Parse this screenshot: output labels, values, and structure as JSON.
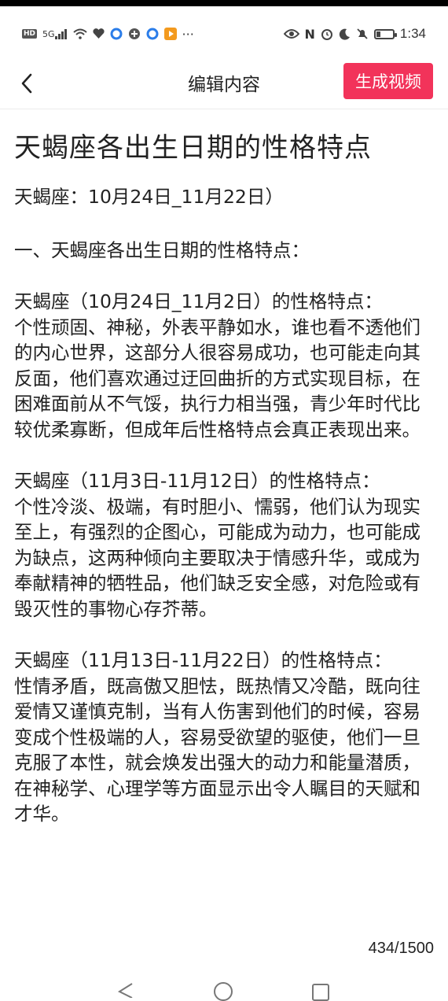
{
  "status_bar": {
    "time": "1:34",
    "left_icons": [
      "hd-icon",
      "signal-icon",
      "wifi-icon",
      "heart-icon",
      "app-c-icon",
      "app-g-icon",
      "app-c2-icon",
      "video-app-icon",
      "more-icon"
    ],
    "right_icons": [
      "eye-icon",
      "nfc-icon",
      "alarm-icon",
      "moon-icon",
      "silent-icon",
      "battery-icon"
    ],
    "hd_label": "HD",
    "signal_label": "5G",
    "more_label": "···",
    "nfc_label": "N"
  },
  "navbar": {
    "title": "编辑内容",
    "action_label": "生成视频",
    "action_color": "#f2335a"
  },
  "document": {
    "title": "天蝎座各出生日期的性格特点",
    "subtitle": "天蝎座：10月24日_11月22日）",
    "heading": "一、天蝎座各出生日期的性格特点：",
    "sections": [
      {
        "heading": "天蝎座（10月24日_11月2日）的性格特点：",
        "body": "个性顽固、神秘，外表平静如水，谁也看不透他们的内心世界，这部分人很容易成功，也可能走向其反面，他们喜欢通过迂回曲折的方式实现目标，在困难面前从不气馁，执行力相当强，青少年时代比较优柔寡断，但成年后性格特点会真正表现出来。"
      },
      {
        "heading": "天蝎座（11月3日-11月12日）的性格特点：",
        "body": "个性冷淡、极端，有时胆小、懦弱，他们认为现实至上，有强烈的企图心，可能成为动力，也可能成为缺点，这两种倾向主要取决于情感升华，或成为奉献精神的牺牲品，他们缺乏安全感，对危险或有毁灭性的事物心存芥蒂。"
      },
      {
        "heading": "天蝎座（11月13日-11月22日）的性格特点：",
        "body": "性情矛盾，既高傲又胆怯，既热情又冷酷，既向往爱情又谨慎克制，当有人伤害到他们的时候，容易变成个性极端的人，容易受欲望的驱使，他们一旦克服了本性，就会焕发出强大的动力和能量潜质，在神秘学、心理学等方面显示出令人瞩目的天赋和才华。"
      }
    ]
  },
  "char_counter": "434/1500"
}
